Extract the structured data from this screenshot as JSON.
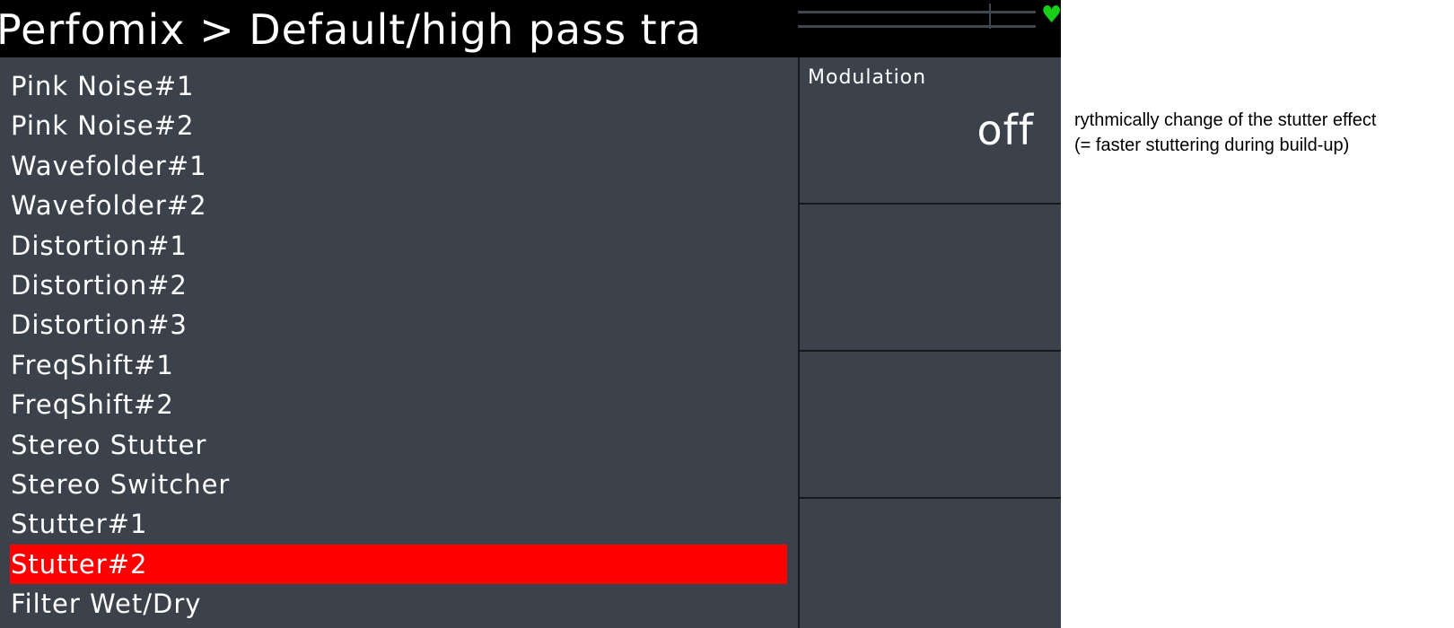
{
  "header": {
    "title": "Perfomix > Default/high pass tra"
  },
  "status": {
    "heart_icon": "heart-icon",
    "heart_color": "#17d017"
  },
  "effects": {
    "items": [
      "Pink Noise#1",
      "Pink Noise#2",
      "Wavefolder#1",
      "Wavefolder#2",
      "Distortion#1",
      "Distortion#2",
      "Distortion#3",
      "FreqShift#1",
      "FreqShift#2",
      "Stereo Stutter",
      "Stereo Switcher",
      "Stutter#1",
      "Stutter#2",
      "Filter Wet/Dry"
    ],
    "selected_index": 12,
    "selected_color": "#ff0000"
  },
  "parameters": {
    "modulation_label": "Modulation",
    "modulation_value": "off"
  },
  "annotation": {
    "line1": "rythmically change of the stutter effect",
    "line2": "(= faster stuttering during build-up)"
  }
}
